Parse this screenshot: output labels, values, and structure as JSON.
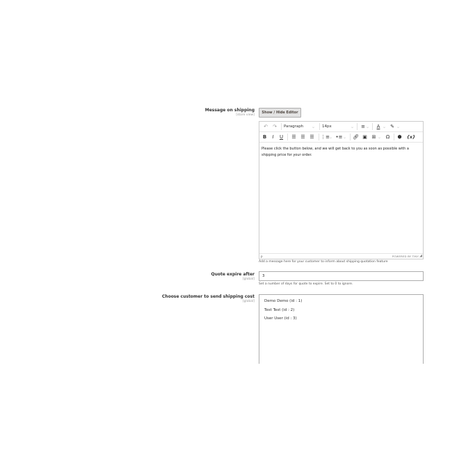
{
  "shipping_message": {
    "label": "Message on shipping",
    "scope": "[store view]",
    "toggle_button": "Show / Hide Editor",
    "toolbar": {
      "block_format": "Paragraph",
      "font_size": "14px",
      "variables_button": "{x}"
    },
    "content": "Please click the button below, and we will get back to you as soon as possible with a shipping price for your order.",
    "status_path": "p",
    "branding": "POWERED BY TINY",
    "note": "Add a message here for your customer to inform about shipping quotation feature"
  },
  "quote_expire": {
    "label": "Quote expire after",
    "scope": "[global]",
    "value": "3",
    "note": "Set a number of days for quote to expire. Set to 0 to ignore."
  },
  "customer_select": {
    "label": "Choose customer to send shipping cost",
    "scope": "[global]",
    "options": [
      "Demo Demo (id : 1)",
      "Test Test (id : 2)",
      "User User (id : 3)"
    ]
  }
}
